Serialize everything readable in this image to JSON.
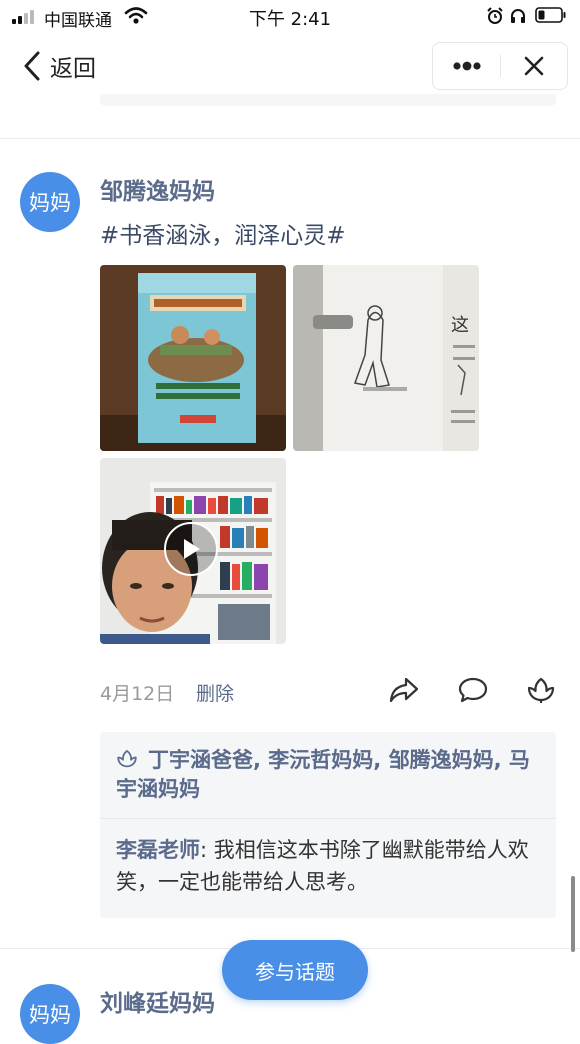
{
  "status_bar": {
    "carrier": "中国联通",
    "time": "下午 2:41",
    "icons": [
      "signal-icon",
      "wifi-icon",
      "alarm-icon",
      "headphone-icon",
      "battery-icon"
    ]
  },
  "nav": {
    "back_label": "返回",
    "icons": [
      "back-chevron-icon",
      "more-icon",
      "close-icon"
    ]
  },
  "posts": [
    {
      "avatar_text": "妈妈",
      "author": "邹腾逸妈妈",
      "topic": "#书香涵泳，润泽心灵#",
      "media": [
        "book-cover-photo",
        "book-page-photo",
        "reading-video"
      ],
      "date": "4月12日",
      "delete_label": "删除",
      "action_icons": [
        "share-icon",
        "comment-icon",
        "like-icon"
      ],
      "likes_text": "丁宇涵爸爸, 李沅哲妈妈, 邹腾逸妈妈, 马宇涵妈妈",
      "comment": {
        "author": "李磊老师",
        "separator": ": ",
        "text": "我相信这本书除了幽默能带给人欢笑，一定也能带给人思考。"
      }
    },
    {
      "avatar_text": "妈妈",
      "author": "刘峰廷妈妈"
    }
  ],
  "join_topic_label": "参与话题",
  "colors": {
    "accent": "#4a8fe7",
    "name": "#5b6b8c",
    "box_bg": "#f5f6f7"
  }
}
